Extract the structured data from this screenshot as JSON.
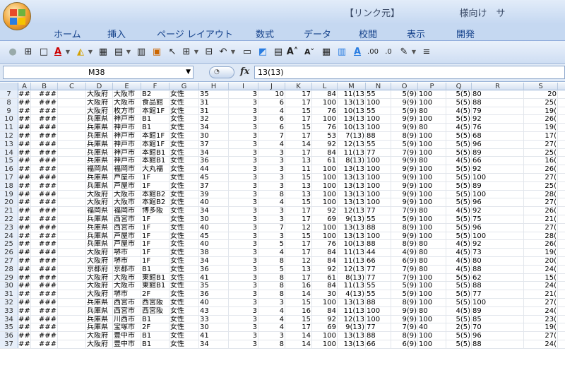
{
  "title": "【リンク元】　　　　　　　様向け　サ",
  "tabs": [
    "ホーム",
    "挿入",
    "ページ レイアウト",
    "数式",
    "データ",
    "校閲",
    "表示",
    "開発"
  ],
  "namebox": "M38",
  "fx_label": "fx",
  "formula": "13(13)",
  "columns": [
    "A",
    "B",
    "C",
    "D",
    "E",
    "F",
    "G",
    "H",
    "I",
    "J",
    "K",
    "L",
    "M",
    "N",
    "O",
    "P",
    "Q",
    "R",
    "S"
  ],
  "rows": [
    [
      "7",
      "###",
      "###",
      "",
      "大阪府",
      "大阪市",
      "B2",
      "女性",
      "35",
      "3",
      "10",
      "17",
      "84",
      "11(13",
      "55",
      "5(9)",
      "100",
      "5(5)",
      "80",
      "20"
    ],
    [
      "8",
      "###",
      "###",
      "",
      "大阪府",
      "大阪市",
      "食品館",
      "女性",
      "31",
      "3",
      "6",
      "17",
      "100",
      "13(13",
      "100",
      "9(9)",
      "100",
      "5(5)",
      "88",
      "25("
    ],
    [
      "9",
      "###",
      "###",
      "",
      "大阪府",
      "枚方市",
      "本館1F",
      "女性",
      "31",
      "3",
      "4",
      "15",
      "76",
      "10(13",
      "55",
      "5(9)",
      "80",
      "4(5)",
      "79",
      "19("
    ],
    [
      "10",
      "###",
      "###",
      "",
      "兵庫県",
      "神戸市",
      "B1",
      "女性",
      "32",
      "3",
      "6",
      "17",
      "100",
      "13(13",
      "100",
      "9(9)",
      "100",
      "5(5)",
      "92",
      "26("
    ],
    [
      "11",
      "###",
      "###",
      "",
      "兵庫県",
      "神戸市",
      "B1",
      "女性",
      "34",
      "3",
      "6",
      "15",
      "76",
      "10(13",
      "100",
      "9(9)",
      "80",
      "4(5)",
      "76",
      "19("
    ],
    [
      "12",
      "###",
      "###",
      "",
      "兵庫県",
      "神戸市",
      "本館1F",
      "女性",
      "30",
      "3",
      "7",
      "17",
      "53",
      "7(13)",
      "88",
      "8(9)",
      "100",
      "5(5)",
      "68",
      "17("
    ],
    [
      "13",
      "###",
      "###",
      "",
      "兵庫県",
      "神戸市",
      "本館1F",
      "女性",
      "37",
      "3",
      "4",
      "14",
      "92",
      "12(13",
      "55",
      "5(9)",
      "100",
      "5(5)",
      "96",
      "27("
    ],
    [
      "14",
      "###",
      "###",
      "",
      "兵庫県",
      "神戸市",
      "本館B1",
      "女性",
      "34",
      "3",
      "3",
      "17",
      "84",
      "11(13",
      "77",
      "7(9)",
      "100",
      "5(5)",
      "89",
      "25("
    ],
    [
      "15",
      "###",
      "###",
      "",
      "兵庫県",
      "神戸市",
      "本館B1",
      "女性",
      "36",
      "3",
      "3",
      "13",
      "61",
      "8(13)",
      "100",
      "9(9)",
      "80",
      "4(5)",
      "66",
      "16("
    ],
    [
      "16",
      "###",
      "###",
      "",
      "福岡県",
      "福岡市",
      "大丸福",
      "女性",
      "44",
      "3",
      "3",
      "11",
      "100",
      "13(13",
      "100",
      "9(9)",
      "100",
      "5(5)",
      "92",
      "26("
    ],
    [
      "17",
      "###",
      "###",
      "",
      "兵庫県",
      "芦屋市",
      "1F",
      "女性",
      "45",
      "3",
      "3",
      "15",
      "100",
      "13(13",
      "100",
      "9(9)",
      "100",
      "5(5)",
      "100",
      "27("
    ],
    [
      "18",
      "###",
      "###",
      "",
      "兵庫県",
      "芦屋市",
      "1F",
      "女性",
      "37",
      "3",
      "3",
      "13",
      "100",
      "13(13",
      "100",
      "9(9)",
      "100",
      "5(5)",
      "89",
      "25("
    ],
    [
      "19",
      "###",
      "###",
      "",
      "大阪府",
      "大阪市",
      "本館B2",
      "女性",
      "39",
      "3",
      "8",
      "13",
      "100",
      "13(13",
      "100",
      "9(9)",
      "100",
      "5(5)",
      "100",
      "28("
    ],
    [
      "20",
      "###",
      "###",
      "",
      "大阪府",
      "大阪市",
      "本館B2",
      "女性",
      "40",
      "3",
      "4",
      "15",
      "100",
      "13(13",
      "100",
      "9(9)",
      "100",
      "5(5)",
      "96",
      "27("
    ],
    [
      "21",
      "###",
      "###",
      "",
      "福岡県",
      "福岡市",
      "博多阪",
      "女性",
      "34",
      "3",
      "3",
      "17",
      "92",
      "12(13",
      "77",
      "7(9)",
      "80",
      "4(5)",
      "92",
      "26("
    ],
    [
      "22",
      "###",
      "###",
      "",
      "兵庫県",
      "西宮市",
      "1F",
      "女性",
      "30",
      "3",
      "3",
      "17",
      "69",
      "9(13)",
      "55",
      "5(9)",
      "100",
      "5(5)",
      "75",
      "21("
    ],
    [
      "23",
      "###",
      "###",
      "",
      "兵庫県",
      "西宮市",
      "1F",
      "女性",
      "40",
      "3",
      "7",
      "12",
      "100",
      "13(13",
      "88",
      "8(9)",
      "100",
      "5(5)",
      "96",
      "27("
    ],
    [
      "24",
      "###",
      "###",
      "",
      "兵庫県",
      "芦屋市",
      "1F",
      "女性",
      "45",
      "3",
      "3",
      "15",
      "100",
      "13(13",
      "100",
      "9(9)",
      "100",
      "5(5)",
      "100",
      "28("
    ],
    [
      "25",
      "###",
      "###",
      "",
      "兵庫県",
      "芦屋市",
      "1F",
      "女性",
      "40",
      "3",
      "5",
      "17",
      "76",
      "10(13",
      "88",
      "8(9)",
      "80",
      "4(5)",
      "92",
      "26("
    ],
    [
      "26",
      "###",
      "###",
      "",
      "大阪府",
      "堺市",
      "1F",
      "女性",
      "38",
      "3",
      "4",
      "17",
      "84",
      "11(13",
      "44",
      "4(9)",
      "80",
      "4(5)",
      "73",
      "19("
    ],
    [
      "27",
      "###",
      "###",
      "",
      "大阪府",
      "堺市",
      "1F",
      "女性",
      "34",
      "3",
      "8",
      "12",
      "84",
      "11(13",
      "66",
      "6(9)",
      "80",
      "4(5)",
      "80",
      "20("
    ],
    [
      "28",
      "###",
      "###",
      "",
      "京都府",
      "京都市",
      "B1",
      "女性",
      "36",
      "3",
      "5",
      "13",
      "92",
      "12(13",
      "77",
      "7(9)",
      "80",
      "4(5)",
      "88",
      "24("
    ],
    [
      "29",
      "###",
      "###",
      "",
      "大阪府",
      "大阪市",
      "東館B1",
      "女性",
      "41",
      "3",
      "8",
      "17",
      "61",
      "8(13)",
      "77",
      "7(9)",
      "100",
      "5(5)",
      "62",
      "15("
    ],
    [
      "30",
      "###",
      "###",
      "",
      "大阪府",
      "大阪市",
      "東館B1",
      "女性",
      "35",
      "3",
      "8",
      "16",
      "84",
      "11(13",
      "55",
      "5(9)",
      "100",
      "5(5)",
      "88",
      "24("
    ],
    [
      "31",
      "###",
      "###",
      "",
      "大阪府",
      "堺市",
      "2F",
      "女性",
      "36",
      "3",
      "8",
      "14",
      "30",
      "4(13)",
      "55",
      "5(9)",
      "100",
      "5(5)",
      "77",
      "21("
    ],
    [
      "32",
      "###",
      "###",
      "",
      "兵庫県",
      "西宮市",
      "西宮阪",
      "女性",
      "40",
      "3",
      "3",
      "15",
      "100",
      "13(13",
      "88",
      "8(9)",
      "100",
      "5(5)",
      "100",
      "27("
    ],
    [
      "33",
      "###",
      "###",
      "",
      "兵庫県",
      "西宮市",
      "西宮阪",
      "女性",
      "43",
      "3",
      "4",
      "16",
      "84",
      "11(13",
      "100",
      "9(9)",
      "80",
      "4(5)",
      "89",
      "24("
    ],
    [
      "34",
      "###",
      "###",
      "",
      "兵庫県",
      "川西市",
      "B1",
      "女性",
      "33",
      "3",
      "4",
      "15",
      "92",
      "12(13",
      "100",
      "9(9)",
      "100",
      "5(5)",
      "85",
      "23("
    ],
    [
      "35",
      "###",
      "###",
      "",
      "兵庫県",
      "宝塚市",
      "2F",
      "女性",
      "30",
      "3",
      "4",
      "17",
      "69",
      "9(13)",
      "77",
      "7(9)",
      "40",
      "2(5)",
      "70",
      "19("
    ],
    [
      "36",
      "###",
      "###",
      "",
      "大阪府",
      "豊中市",
      "B1",
      "女性",
      "41",
      "3",
      "3",
      "14",
      "100",
      "13(13",
      "88",
      "8(9)",
      "100",
      "5(5)",
      "96",
      "27("
    ],
    [
      "37",
      "###",
      "###",
      "",
      "大阪府",
      "豊中市",
      "B1",
      "女性",
      "34",
      "3",
      "8",
      "14",
      "100",
      "13(13",
      "66",
      "6(9)",
      "100",
      "5(5)",
      "88",
      "24("
    ]
  ]
}
